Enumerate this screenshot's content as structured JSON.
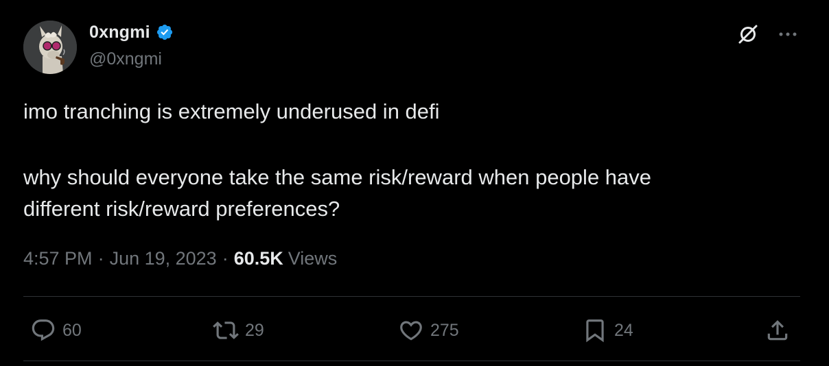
{
  "author": {
    "display_name": "0xngmi",
    "handle": "@0xngmi",
    "verified": true,
    "verified_color": "#1d9bf0"
  },
  "top_actions": {
    "grok_icon": "grok-icon",
    "more_icon": "more-horizontal-icon"
  },
  "tweet": {
    "paragraph_1": "imo tranching is extremely underused in defi",
    "paragraph_2_line_1": "why should everyone take the same risk/reward when people have",
    "paragraph_2_line_2": "different risk/reward preferences?"
  },
  "meta": {
    "time": "4:57 PM",
    "separator": "·",
    "date": "Jun 19, 2023",
    "views_count": "60.5K",
    "views_label": "Views"
  },
  "actions": {
    "reply": {
      "icon": "reply-icon",
      "count": "60"
    },
    "retweet": {
      "icon": "retweet-icon",
      "count": "29"
    },
    "like": {
      "icon": "heart-icon",
      "count": "275"
    },
    "bookmark": {
      "icon": "bookmark-icon",
      "count": "24"
    },
    "share": {
      "icon": "share-icon"
    }
  },
  "colors": {
    "background": "#000000",
    "primary_text": "#e7e9ea",
    "secondary_text": "#71767b",
    "divider": "#2f3336",
    "verified": "#1d9bf0"
  }
}
